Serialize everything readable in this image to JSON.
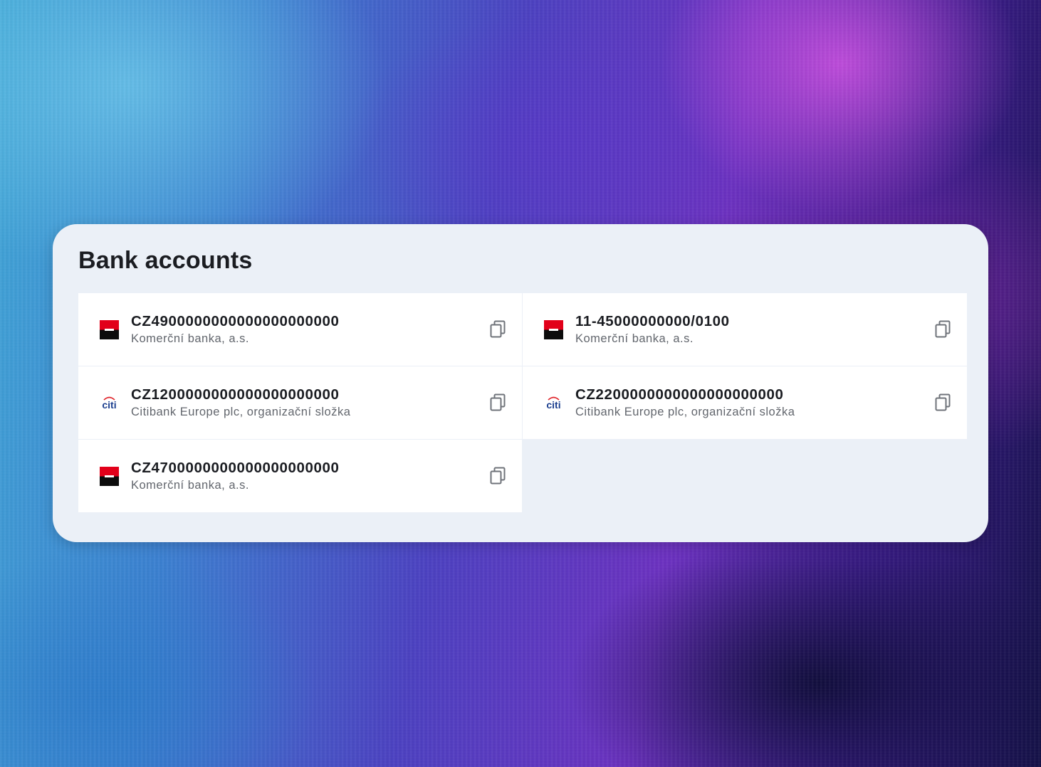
{
  "card": {
    "title": "Bank accounts"
  },
  "accounts": [
    {
      "number": "CZ4900000000000000000000",
      "bank": "Komerční banka, a.s.",
      "logo_icon": "kb-logo-icon"
    },
    {
      "number": "11-45000000000/0100",
      "bank": "Komerční banka, a.s.",
      "logo_icon": "kb-logo-icon"
    },
    {
      "number": "CZ1200000000000000000000",
      "bank": "Citibank Europe plc, organizační složka",
      "logo_icon": "citi-logo-icon"
    },
    {
      "number": "CZ2200000000000000000000",
      "bank": "Citibank Europe plc, organizační složka",
      "logo_icon": "citi-logo-icon"
    },
    {
      "number": "CZ4700000000000000000000",
      "bank": "Komerční banka, a.s.",
      "logo_icon": "kb-logo-icon"
    }
  ],
  "icons": {
    "copy": "copy-icon"
  },
  "colors": {
    "card_background": "#ebf0f7",
    "item_background": "#ffffff",
    "title_text": "#1b1d22",
    "secondary_text": "#62666d",
    "kb_red": "#e2001a",
    "kb_black": "#0c0c0c",
    "citi_blue": "#1c3f8f",
    "citi_red": "#e0262c"
  }
}
